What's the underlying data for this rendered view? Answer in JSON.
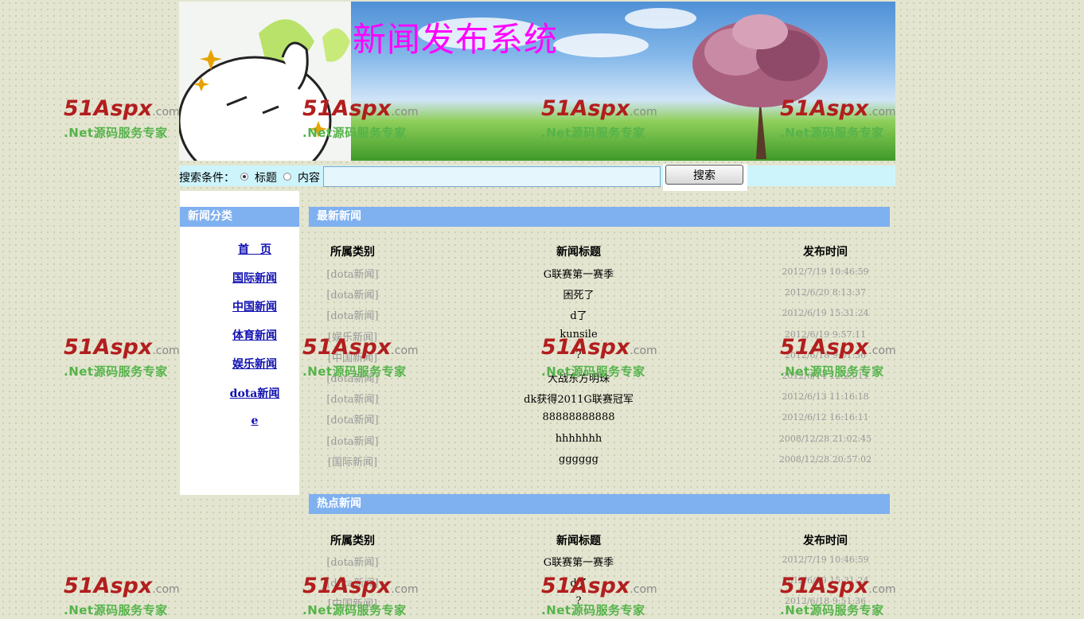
{
  "banner": {
    "title": "新闻发布系统"
  },
  "search": {
    "label": "搜索条件：",
    "options": [
      {
        "label": "标题",
        "checked": true
      },
      {
        "label": "内容",
        "checked": false
      }
    ],
    "value": "",
    "button": "搜索"
  },
  "sidebar": {
    "header": "新闻分类",
    "items": [
      "首　页",
      "国际新闻",
      "中国新闻",
      "体育新闻",
      "娱乐新闻",
      "dota新闻",
      "e"
    ]
  },
  "latest": {
    "header": "最新新闻",
    "columns": [
      "所属类别",
      "新闻标题",
      "发布时间"
    ],
    "rows": [
      {
        "category": "[dota新闻]",
        "title": "G联赛第一赛季",
        "time": "2012/7/19 10:46:59"
      },
      {
        "category": "[dota新闻]",
        "title": "困死了",
        "time": "2012/6/20 8:13:37"
      },
      {
        "category": "[dota新闻]",
        "title": "d了",
        "time": "2012/6/19 15:31:24"
      },
      {
        "category": "[娱乐新闻]",
        "title": "kunsile",
        "time": "2012/6/19 9:57:11"
      },
      {
        "category": "[中国新闻]",
        "title": "?",
        "time": "2012/6/18 9:51:36"
      },
      {
        "category": "[dota新闻]",
        "title": "大战东方明珠",
        "time": "2012/6/14 12:23:11"
      },
      {
        "category": "[dota新闻]",
        "title": "dk获得2011G联赛冠军",
        "time": "2012/6/13 11:16:18"
      },
      {
        "category": "[dota新闻]",
        "title": "88888888888",
        "time": "2012/6/12 16:16:11"
      },
      {
        "category": "[dota新闻]",
        "title": "hhhhhhh",
        "time": "2008/12/28 21:02:45"
      },
      {
        "category": "[国际新闻]",
        "title": "gggggg",
        "time": "2008/12/28 20:57:02"
      }
    ]
  },
  "hot": {
    "header": "热点新闻",
    "columns": [
      "所属类别",
      "新闻标题",
      "发布时间"
    ],
    "rows": [
      {
        "category": "[dota新闻]",
        "title": "G联赛第一赛季",
        "time": "2012/7/19 10:46:59"
      },
      {
        "category": "[dota新闻]",
        "title": "d了",
        "time": "2012/6/19 15:31:24"
      },
      {
        "category": "[中国新闻]",
        "title": "?",
        "time": "2012/6/18 9:51:36"
      }
    ]
  },
  "watermark": {
    "logo_main": "51Aspx",
    "logo_suffix": ".com",
    "slogan": ".Net源码服务专家"
  },
  "colors": {
    "accent_header": "#7fb0ef",
    "link": "#1010b0",
    "title_magenta": "#ff00ff",
    "search_bar": "#cdf4fb"
  }
}
